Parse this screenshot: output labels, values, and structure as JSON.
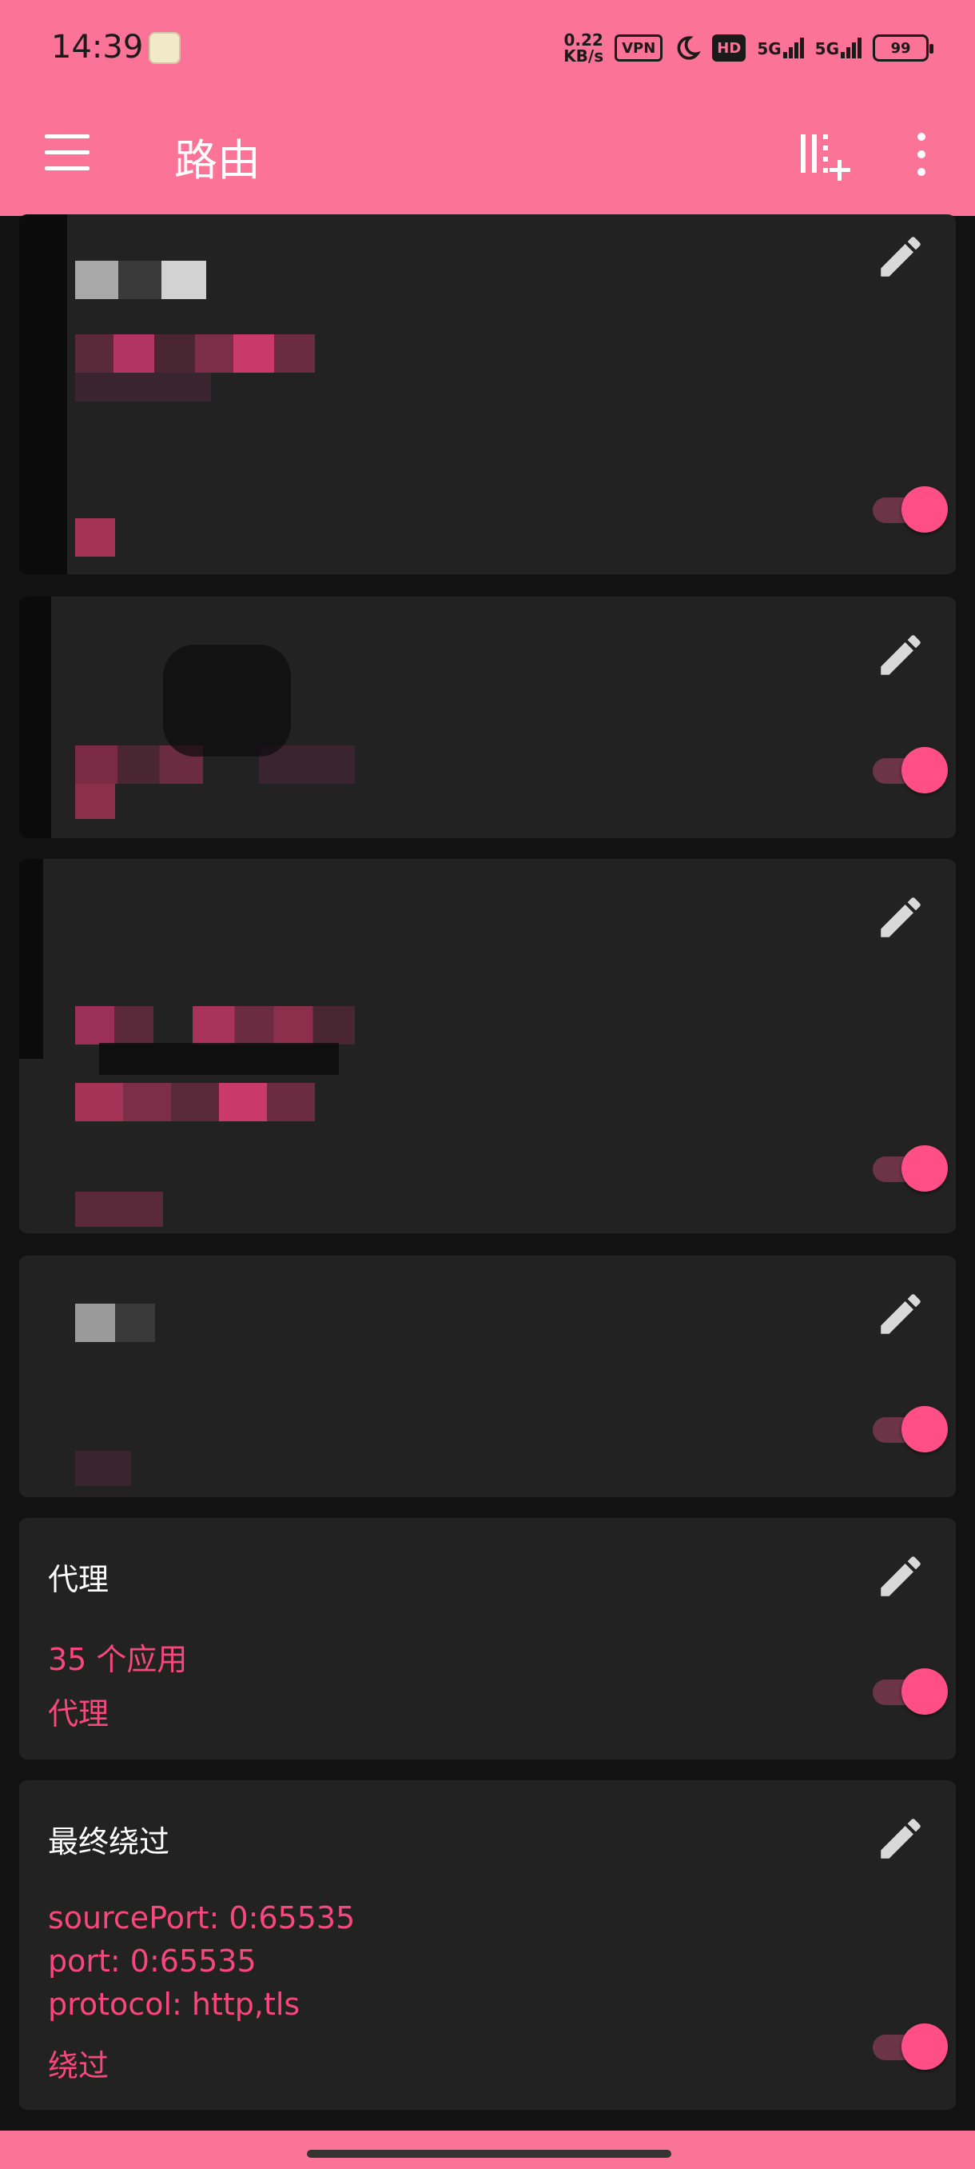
{
  "status": {
    "time": "14:39",
    "speed_value": "0.22",
    "speed_unit": "KB/s",
    "vpn": "VPN",
    "hd": "HD",
    "net1": "5G",
    "net2": "5G",
    "battery": "99"
  },
  "appbar": {
    "title": "路由"
  },
  "cards": {
    "proxy": {
      "title": "代理",
      "line1": "35 个应用",
      "line2": "代理"
    },
    "final_bypass": {
      "title": "最终绕过",
      "line1": "sourcePort: 0:65535",
      "line2": "port: 0:65535",
      "line3": "protocol: http,tls",
      "line4": "绕过"
    }
  },
  "colors": {
    "accent": "#FB7397",
    "switch_on": "#FF4F86",
    "card_bg": "#222222",
    "text_accent": "#F7477E"
  }
}
